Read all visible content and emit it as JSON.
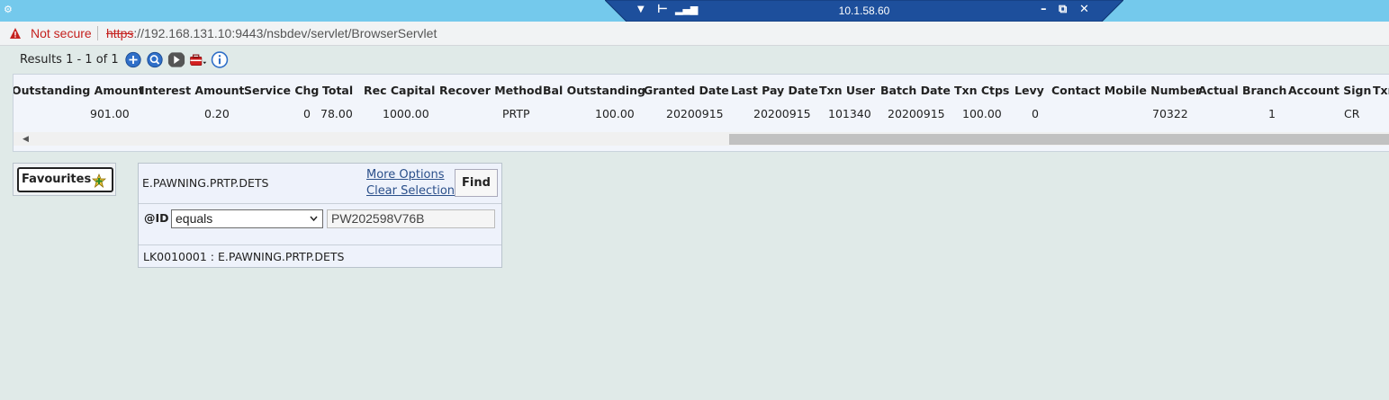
{
  "remote": {
    "ip": "10.1.58.60"
  },
  "addressbar": {
    "security_label": "Not secure",
    "url_scheme": "https",
    "url_rest": "://192.168.131.10:9443/nsbdev/servlet/BrowserServlet"
  },
  "results": {
    "text": "Results 1 - 1 of 1"
  },
  "grid": {
    "headers": [
      "Outstanding Amount",
      "Interest Amount",
      "Service Chg",
      "Total",
      "Rec Capital",
      "Recover Method",
      "Bal Outstanding",
      "Granted Date",
      "Last Pay Date",
      "Txn User",
      "Batch Date",
      "Txn Ctps",
      "Levy",
      "Contact Mobile Number",
      "Actual Branch",
      "Account Sign",
      "Txn"
    ],
    "row": [
      "901.00",
      "0.20",
      "0",
      "78.00",
      "1000.00",
      "PRTP",
      "100.00",
      "20200915",
      "20200915",
      "101340",
      "20200915",
      "100.00",
      "0",
      "70322",
      "1",
      "CR",
      ""
    ]
  },
  "favourites": {
    "label": "Favourites"
  },
  "selection": {
    "enquiry_name": "E.PAWNING.PRTP.DETS",
    "more_options": "More Options",
    "clear_selection": "Clear Selection",
    "find_label": "Find",
    "field_label": "@ID",
    "operator": "equals",
    "value": "PW202598V76B",
    "footer": "LK0010001 : E.PAWNING.PRTP.DETS"
  },
  "colors": {
    "remote_bar": "#74c9ec",
    "rdp_bar": "#1d4f9c",
    "link": "#2a4f8a",
    "warning": "#c5221f"
  }
}
